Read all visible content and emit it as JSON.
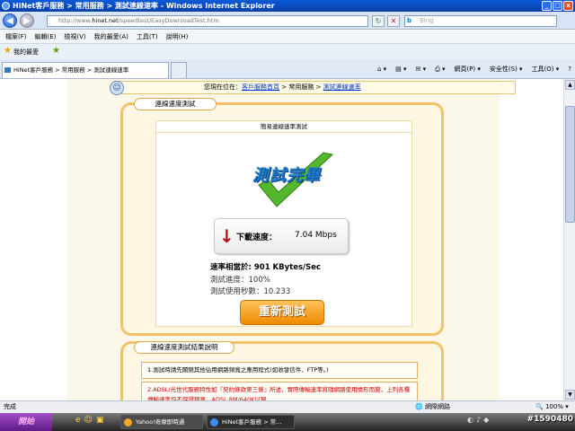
{
  "window": {
    "title": "HiNet客戶服務 > 常用服務 > 測試連線速率 - Windows Internet Explorer",
    "minimize": "_",
    "maximize": "□",
    "close": "x"
  },
  "address_bar": {
    "url_prefix": "http://www.",
    "url_domain": "hinet.net",
    "url_path": "/speedtest/EasyDownloadTest.htm",
    "search_engine": "b",
    "search_placeholder": "Bing",
    "refresh_icon": "↻",
    "stop_icon": "✕",
    "back_icon": "◀",
    "forward_icon": "▶"
  },
  "menu": [
    "檔案(F)",
    "編輯(E)",
    "檢視(V)",
    "我的最愛(A)",
    "工具(T)",
    "說明(H)"
  ],
  "favorites_bar": {
    "label": "我的最愛"
  },
  "tab": {
    "label": "HiNet客戶服務 > 常用服務 > 測試連線速率"
  },
  "command_bar": [
    "網頁(P) ▾",
    "安全性(S) ▾",
    "工具(O) ▾",
    "?"
  ],
  "page": {
    "breadcrumb_prefix": "您現在位在：",
    "breadcrumb_link1": "客戶服務首頁",
    "breadcrumb_sep1": " > 常用服務 > ",
    "breadcrumb_link2": "測試連線速率",
    "panel_title": "連線速度測試",
    "result_header": "簡易連線速率測試",
    "done_text": "測試完畢",
    "speed_label": "下載速度：",
    "speed_value": "7.04 Mbps",
    "equivalent_line": "速率相當於: 901 KBytes/Sec",
    "progress_line": "測試進度：100%",
    "duration_line": "測試使用秒數：10.233",
    "retest_button": "重新測試",
    "notes_title": "連線速度測試結果說明",
    "notes": [
      "1.測試時請先關閉其他佔用網路頻寬之應用程式(如收發信件、FTP等。)",
      "2.ADSL/光世代服務特性如『契約條款第三條』所述，實際傳輸速率將隨網路使用情形而變，上列各種傳輸速率均不保證頻寬。ADSL 8M/640K以現"
    ]
  },
  "status_bar": {
    "left": "完成",
    "zone": "網際網路",
    "zoom": "100%"
  },
  "taskbar": {
    "start_label": "開始",
    "items": [
      "Yahoo!奇摩即時通",
      "HiNet客戶服務 > 常..."
    ]
  },
  "watermark": "#1590480"
}
